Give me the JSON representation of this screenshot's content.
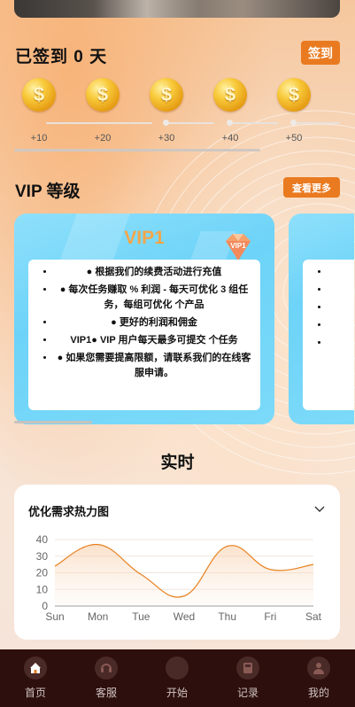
{
  "checkin": {
    "title": "已签到 0 天",
    "button_label": "签到",
    "coins": [
      {
        "label": "+10"
      },
      {
        "label": "+20"
      },
      {
        "label": "+30"
      },
      {
        "label": "+40"
      },
      {
        "label": "+50"
      }
    ]
  },
  "vip_section": {
    "title": "VIP 等级",
    "more_label": "查看更多",
    "cards": [
      {
        "name": "VIP1",
        "badge": "VIP1",
        "benefits": [
          "● 根据我们的续费活动进行充值",
          "● 每次任务赚取 % 利润 - 每天可优化 3 组任务，每组可优化 个产品",
          "● 更好的利润和佣金",
          "VIP1● VIP 用户每天最多可提交 个任务",
          "● 如果您需要提高限额，请联系我们的在线客服申请。"
        ]
      }
    ]
  },
  "realtime": {
    "title": "实时",
    "heat_card_title": "优化需求热力图"
  },
  "chart_data": {
    "type": "area",
    "categories": [
      "Sun",
      "Mon",
      "Tue",
      "Wed",
      "Thu",
      "Fri",
      "Sat"
    ],
    "series": [
      {
        "values": [
          24,
          37,
          19,
          6,
          36,
          22,
          25
        ]
      }
    ],
    "yticks": [
      0,
      10,
      20,
      30,
      40
    ],
    "ylim": [
      0,
      40
    ],
    "line_color": "#e8801e",
    "grid": true
  },
  "nav": [
    {
      "label": "首页",
      "icon": "home-icon",
      "active": true
    },
    {
      "label": "客服",
      "icon": "support-icon",
      "active": false
    },
    {
      "label": "开始",
      "icon": "start-icon",
      "active": false
    },
    {
      "label": "记录",
      "icon": "record-icon",
      "active": false
    },
    {
      "label": "我的",
      "icon": "profile-icon",
      "active": false
    }
  ],
  "colors": {
    "accent": "#ea7a20",
    "navbar": "#2d0f0d",
    "vip_card": "#6dd3f8"
  }
}
